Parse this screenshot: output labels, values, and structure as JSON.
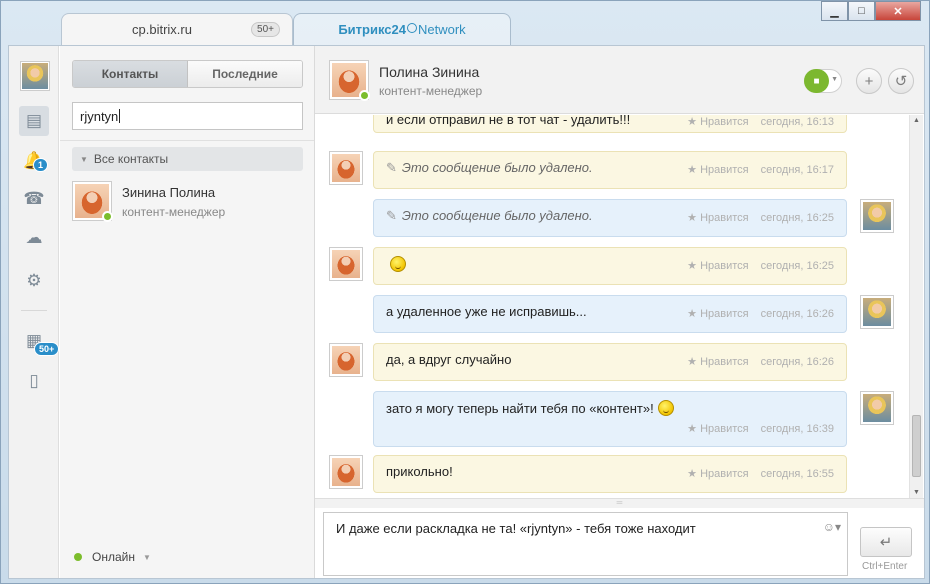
{
  "window": {
    "tabs": [
      {
        "label": "cp.bitrix.ru",
        "badge": "50+"
      },
      {
        "label_brand": "Битрикс24",
        "label_suffix": "Network"
      }
    ],
    "controls": {
      "minimize": "▁",
      "maximize": "□",
      "close": "✕"
    }
  },
  "iconbar": {
    "items": [
      {
        "name": "chat-icon",
        "glyph": "▤"
      },
      {
        "name": "notifications-icon",
        "glyph": "🔔",
        "badge": "1"
      },
      {
        "name": "phone-icon",
        "glyph": "☎"
      },
      {
        "name": "disk-icon",
        "glyph": "☁"
      },
      {
        "name": "settings-icon",
        "glyph": "⚙"
      },
      {
        "name": "apps-icon",
        "glyph": "▦",
        "badge": "50+"
      },
      {
        "name": "book-icon",
        "glyph": "▯"
      }
    ]
  },
  "left": {
    "tabs": {
      "contacts": "Контакты",
      "recent": "Последние"
    },
    "search": {
      "value": "rjyntyn"
    },
    "group": {
      "label": "Все контакты"
    },
    "contact": {
      "name": "Зинина Полина",
      "role": "контент-менеджер"
    },
    "status": {
      "label": "Онлайн"
    }
  },
  "chat": {
    "header": {
      "name": "Полина Зинина",
      "role": "контент-менеджер"
    },
    "like_label": "Нравится",
    "messages": [
      {
        "side": "in",
        "text": "и если отправил не в тот чат - удалить!!!",
        "time": "сегодня, 16:13",
        "deleted": false
      },
      {
        "side": "in",
        "text": "Это сообщение было удалено.",
        "time": "сегодня, 16:17",
        "deleted": true
      },
      {
        "side": "out",
        "text": "Это сообщение было удалено.",
        "time": "сегодня, 16:25",
        "deleted": true
      },
      {
        "side": "in",
        "text": "",
        "time": "сегодня, 16:25",
        "deleted": false,
        "smile": true
      },
      {
        "side": "out",
        "text": "а удаленное уже не исправишь...",
        "time": "сегодня, 16:26",
        "deleted": false
      },
      {
        "side": "in",
        "text": "да, а вдруг случайно",
        "time": "сегодня, 16:26",
        "deleted": false
      },
      {
        "side": "out",
        "text": "зато я могу теперь найти тебя по «контент»!",
        "time": "сегодня, 16:39",
        "deleted": false,
        "smile": true
      },
      {
        "side": "in",
        "text": "прикольно!",
        "time": "сегодня, 16:55",
        "deleted": false
      }
    ],
    "input": {
      "value": "И даже если раскладка не та!  «rjyntyn» - тебя тоже находит"
    },
    "send_hint": "Ctrl+Enter"
  },
  "colors": {
    "accent": "#2a8ec9",
    "online": "#7cbd2c",
    "video": "#7cb82f"
  }
}
